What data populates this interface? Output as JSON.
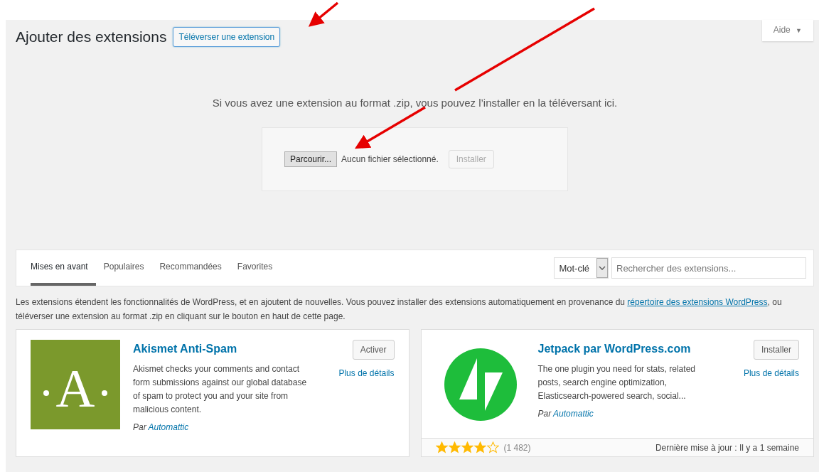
{
  "help_tab": {
    "label": "Aide",
    "caret": "▼"
  },
  "heading": {
    "title": "Ajouter des extensions",
    "upload_button": "Téléverser une extension"
  },
  "upload": {
    "message": "Si vous avez une extension au format .zip, vous pouvez l’installer en la téléversant ici.",
    "browse_button": "Parcourir...",
    "file_status": "Aucun fichier sélectionné.",
    "install_button": {
      "label": "Installer",
      "disabled": true
    }
  },
  "filter_tabs": [
    {
      "label": "Mises en avant",
      "selected": true
    },
    {
      "label": "Populaires",
      "selected": false
    },
    {
      "label": "Recommandées",
      "selected": false
    },
    {
      "label": "Favorites",
      "selected": false
    }
  ],
  "search": {
    "type_select": "Mot-clé",
    "placeholder": "Rechercher des extensions..."
  },
  "intro": {
    "text_before": "Les extensions étendent les fonctionnalités de WordPress, et en ajoutent de nouvelles. Vous pouvez installer des extensions automatiquement en provenance du",
    "link": "répertoire des extensions WordPress",
    "text_after": ", ou téléverser une extension au format .zip en cliquant sur le bouton en haut de cette page."
  },
  "plugins": [
    {
      "name": "Akismet Anti-Spam",
      "kind": "akismet",
      "logo_letter": "A",
      "action": "Activer",
      "details": "Plus de détails",
      "description": "Akismet checks your comments and contact form submissions against our global database of spam to protect you and your site from malicious content.",
      "by": "Par",
      "author": "Automattic"
    },
    {
      "name": "Jetpack par WordPress.com",
      "kind": "jetpack",
      "action": "Installer",
      "details": "Plus de détails",
      "description": "The one plugin you need for stats, related posts, search engine optimization, Elasticsearch-powered search, social...",
      "by": "Par",
      "author": "Automattic",
      "footer": {
        "stars": 4,
        "rating_count": "(1 482)",
        "updated": "Dernière mise à jour : Il y a 1 semaine"
      }
    }
  ]
}
